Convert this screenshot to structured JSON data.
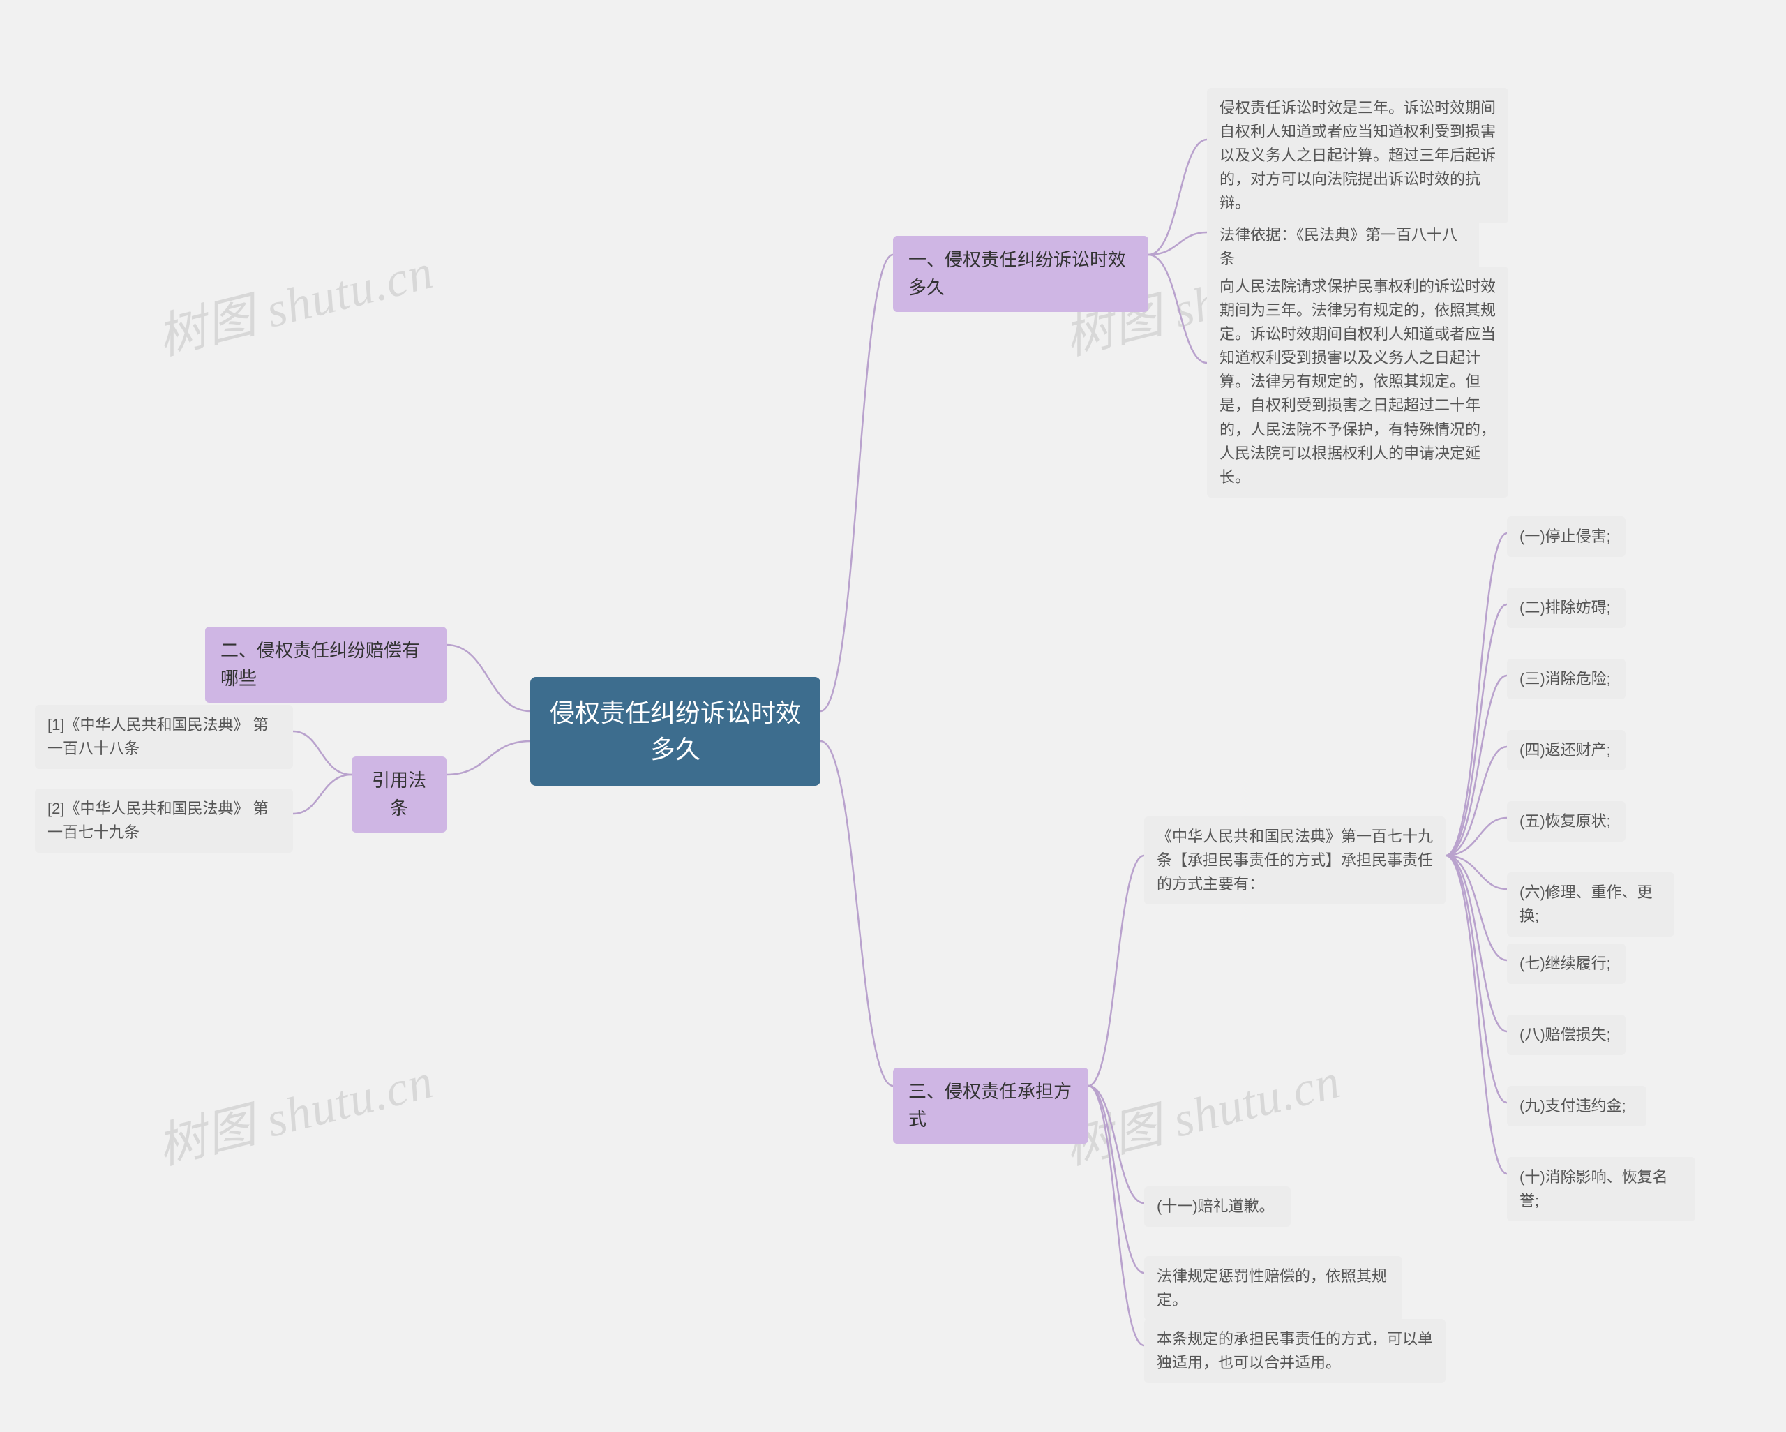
{
  "root": "侵权责任纠纷诉讼时效多久",
  "left": {
    "branch2": "二、侵权责任纠纷赔偿有哪些",
    "citeHeader": "引用法条",
    "cite1": "[1]《中华人民共和国民法典》 第一百八十八条",
    "cite2": "[2]《中华人民共和国民法典》 第一百七十九条"
  },
  "right": {
    "b1": {
      "title": "一、侵权责任纠纷诉讼时效多久",
      "n1": "侵权责任诉讼时效是三年。诉讼时效期间自权利人知道或者应当知道权利受到损害以及义务人之日起计算。超过三年后起诉的，对方可以向法院提出诉讼时效的抗辩。",
      "n2": "法律依据：《民法典》第一百八十八条",
      "n3": "向人民法院请求保护民事权利的诉讼时效期间为三年。法律另有规定的，依照其规定。诉讼时效期间自权利人知道或者应当知道权利受到损害以及义务人之日起计算。法律另有规定的，依照其规定。但是，自权利受到损害之日起超过二十年的，人民法院不予保护，有特殊情况的，人民法院可以根据权利人的申请决定延长。"
    },
    "b3": {
      "title": "三、侵权责任承担方式",
      "law": "《中华人民共和国民法典》第一百七十九条【承担民事责任的方式】承担民事责任的方式主要有：",
      "i1": "(一)停止侵害;",
      "i2": "(二)排除妨碍;",
      "i3": "(三)消除危险;",
      "i4": "(四)返还财产;",
      "i5": "(五)恢复原状;",
      "i6": "(六)修理、重作、更换;",
      "i7": "(七)继续履行;",
      "i8": "(八)赔偿损失;",
      "i9": "(九)支付违约金;",
      "i10": "(十)消除影响、恢复名誉;",
      "i11": "(十一)赔礼道歉。",
      "extra1": "法律规定惩罚性赔偿的，依照其规定。",
      "extra2": "本条规定的承担民事责任的方式，可以单独适用，也可以合并适用。"
    }
  },
  "watermark": "树图 shutu.cn"
}
